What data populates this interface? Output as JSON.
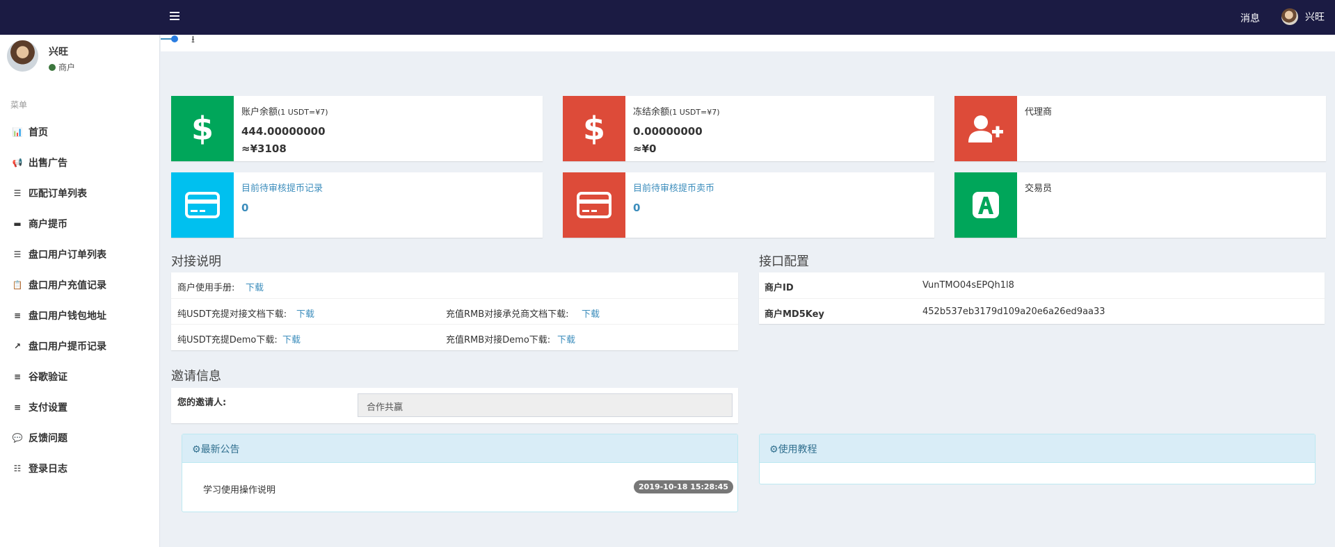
{
  "topbar": {
    "messages": "消息",
    "username": "兴旺"
  },
  "user": {
    "name": "兴旺",
    "role": "商户"
  },
  "menu": {
    "header": "菜单",
    "items": [
      {
        "label": "首页",
        "icon": "bar-chart-icon",
        "glyph": "📊"
      },
      {
        "label": "出售广告",
        "icon": "bullhorn-icon",
        "glyph": "📢"
      },
      {
        "label": "匹配订单列表",
        "icon": "list-icon",
        "glyph": "☰"
      },
      {
        "label": "商户提币",
        "icon": "credit-card-icon",
        "glyph": "▬"
      },
      {
        "label": "盘口用户订单列表",
        "icon": "list-icon",
        "glyph": "☰"
      },
      {
        "label": "盘口用户充值记录",
        "icon": "clipboard-icon",
        "glyph": "📋"
      },
      {
        "label": "盘口用户钱包地址",
        "icon": "bars-icon",
        "glyph": "≡"
      },
      {
        "label": "盘口用户提币记录",
        "icon": "external-link-icon",
        "glyph": "↗"
      },
      {
        "label": "谷歌验证",
        "icon": "bars-icon",
        "glyph": "≡"
      },
      {
        "label": "支付设置",
        "icon": "bars-icon",
        "glyph": "≡"
      },
      {
        "label": "反馈问题",
        "icon": "comment-icon",
        "glyph": "💬"
      },
      {
        "label": "登录日志",
        "icon": "list-ol-icon",
        "glyph": "☷"
      }
    ]
  },
  "stats": {
    "balance": {
      "label": "账户余额",
      "rate": "(1 USDT=¥7)",
      "value": "444.00000000",
      "cny": "≈¥3108"
    },
    "frozen": {
      "label": "冻结余额",
      "rate": "(1 USDT=¥7)",
      "value": "0.00000000",
      "cny": "≈¥0"
    },
    "agent": {
      "label": "代理商"
    },
    "pending_withdraw": {
      "label": "目前待审核提币记录",
      "value": "0"
    },
    "pending_sell": {
      "label": "目前待审核提币卖币",
      "value": "0"
    },
    "trader": {
      "label": "交易员"
    }
  },
  "integration": {
    "title": "对接说明",
    "manual_label": "商户使用手册:",
    "download": "下载",
    "usdt_doc_label": "纯USDT充提对接文档下载:",
    "rmb_doc_label": "充值RMB对接承兑商文档下载:",
    "usdt_demo_label": "纯USDT充提Demo下载:",
    "rmb_demo_label": "充值RMB对接Demo下载:"
  },
  "api": {
    "title": "接口配置",
    "rows": [
      {
        "key": "商户ID",
        "value": "VunTMO04sEPQh1l8"
      },
      {
        "key": "商户MD5Key",
        "value": "452b537eb3179d109a20e6a26ed9aa33"
      }
    ]
  },
  "invite": {
    "title": "邀请信息",
    "label": "您的邀请人:",
    "value": "合作共赢"
  },
  "announcement": {
    "title": "最新公告",
    "item": "学习使用操作说明",
    "date": "2019-10-18 15:28:45"
  },
  "tutorial": {
    "title": "使用教程"
  },
  "colors": {
    "topbar": "#1b1b43",
    "green": "#00a65a",
    "red": "#dd4b39",
    "aqua": "#00c0ef",
    "link": "#3c8dbc"
  }
}
